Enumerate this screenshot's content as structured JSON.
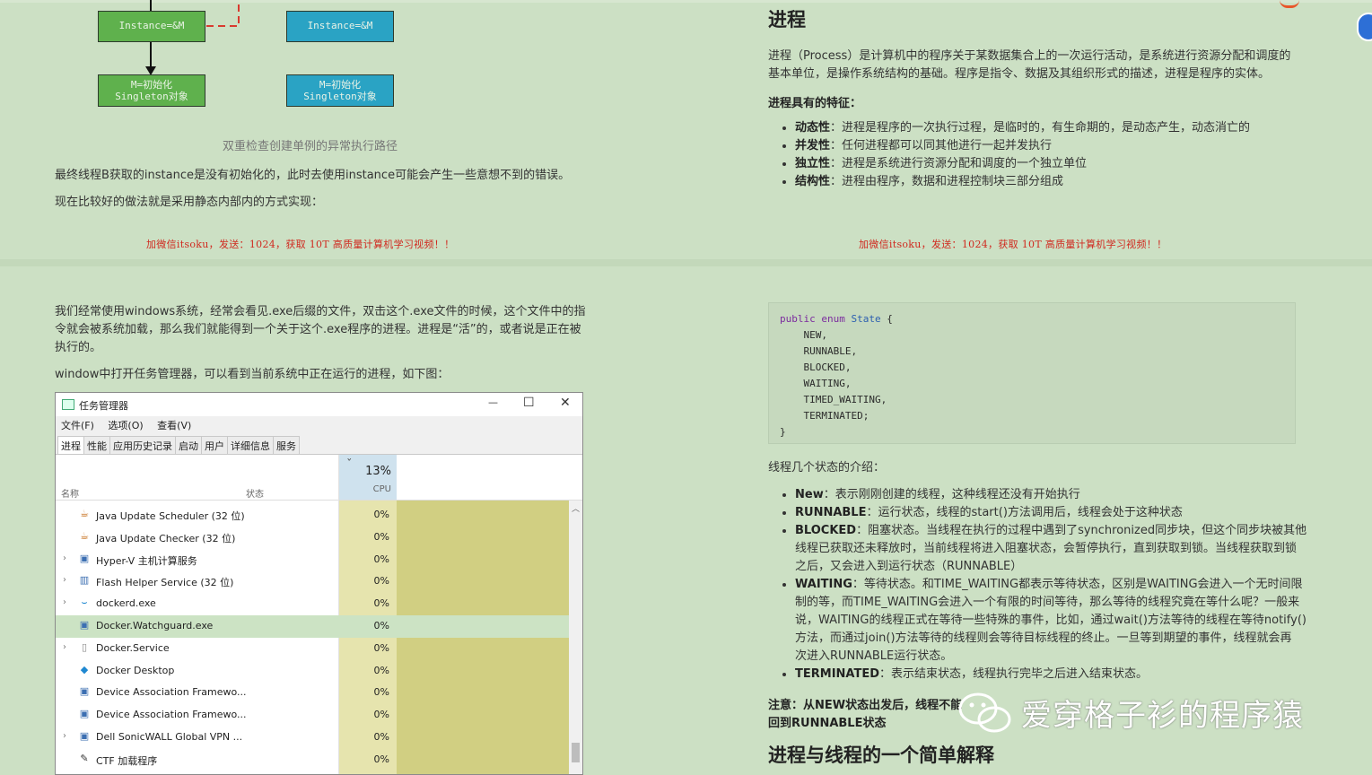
{
  "diagram": {
    "box_left_top": "Instance=&M",
    "box_right_top": "Instance=&M",
    "box_left_bottom_1": "M=初始化",
    "box_left_bottom_2": "Singleton对象",
    "box_right_bottom_1": "M=初始化",
    "box_right_bottom_2": "Singleton对象",
    "caption": "双重检查创建单例的异常执行路径"
  },
  "left_top": {
    "para1": "最终线程B获取的instance是没有初始化的，此时去使用instance可能会产生一些意想不到的错误。",
    "para2": "现在比较好的做法就是采用静态内部内的方式实现：",
    "promo": "加微信itsoku，发送：1024，获取 10T 高质量计算机学习视频！！"
  },
  "right_top": {
    "heading": "进程",
    "para_line1": "进程（Process）是计算机中的程序关于某数据集合上的一次运行活动，是系统进行资源分配和调度的",
    "para_line2": "基本单位，是操作系统结构的基础。程序是指令、数据及其组织形式的描述，进程是程序的实体。",
    "features_title": "进程具有的特征：",
    "features": [
      {
        "term": "动态性",
        "desc": "：进程是程序的一次执行过程，是临时的，有生命期的，是动态产生，动态消亡的"
      },
      {
        "term": "并发性",
        "desc": "：任何进程都可以同其他进行一起并发执行"
      },
      {
        "term": "独立性",
        "desc": "：进程是系统进行资源分配和调度的一个独立单位"
      },
      {
        "term": "结构性",
        "desc": "：进程由程序，数据和进程控制块三部分组成"
      }
    ],
    "promo": "加微信itsoku，发送：1024，获取 10T 高质量计算机学习视频！！"
  },
  "left_bottom": {
    "para1_line1": "我们经常使用windows系统，经常会看见.exe后缀的文件，双击这个.exe文件的时候，这个文件中的指",
    "para1_line2": "令就会被系统加载，那么我们就能得到一个关于这个.exe程序的进程。进程是“活”的，或者说是正在被",
    "para1_line3": "执行的。",
    "para2": "window中打开任务管理器，可以看到当前系统中正在运行的进程，如下图："
  },
  "task_manager": {
    "title": "任务管理器",
    "minimize": "—",
    "maximize": "☐",
    "close": "✕",
    "menu": [
      "文件(F)",
      "选项(O)",
      "查看(V)"
    ],
    "tabs": [
      "进程",
      "性能",
      "应用历史记录",
      "启动",
      "用户",
      "详细信息",
      "服务"
    ],
    "col_name": "名称",
    "col_status": "状态",
    "cpu_percent": "13%",
    "col_cpu": "CPU",
    "sort_arrow": "ˇ",
    "rows": [
      {
        "expand": "",
        "icon": "java-icon",
        "glyph": "☕",
        "name": "Java Update Scheduler (32 位)",
        "cpu": "0%"
      },
      {
        "expand": "",
        "icon": "java-icon",
        "glyph": "☕",
        "name": "Java Update Checker (32 位)",
        "cpu": "0%"
      },
      {
        "expand": "›",
        "icon": "service-icon",
        "glyph": "▣",
        "name": "Hyper-V 主机计算服务",
        "cpu": "0%"
      },
      {
        "expand": "›",
        "icon": "service-icon",
        "glyph": "▥",
        "name": "Flash Helper Service (32 位)",
        "cpu": "0%"
      },
      {
        "expand": "›",
        "icon": "docker-icon",
        "glyph": "⌣",
        "name": "dockerd.exe",
        "cpu": "0%"
      },
      {
        "expand": "",
        "icon": "service-icon",
        "glyph": "▣",
        "name": "Docker.Watchguard.exe",
        "cpu": "0%"
      },
      {
        "expand": "›",
        "icon": "file-icon",
        "glyph": "▯",
        "name": "Docker.Service",
        "cpu": "0%"
      },
      {
        "expand": "",
        "icon": "docker-icon",
        "glyph": "◆",
        "name": "Docker Desktop",
        "cpu": "0%"
      },
      {
        "expand": "",
        "icon": "service-icon",
        "glyph": "▣",
        "name": "Device Association Framewo...",
        "cpu": "0%"
      },
      {
        "expand": "",
        "icon": "service-icon",
        "glyph": "▣",
        "name": "Device Association Framewo...",
        "cpu": "0%"
      },
      {
        "expand": "›",
        "icon": "service-icon",
        "glyph": "▣",
        "name": "Dell SonicWALL Global VPN ...",
        "cpu": "0%"
      },
      {
        "expand": "",
        "icon": "pen-icon",
        "glyph": "✎",
        "name": "CTF 加载程序",
        "cpu": "0%"
      }
    ]
  },
  "right_bottom": {
    "code": [
      "public enum State {",
      "    NEW,",
      "    RUNNABLE,",
      "    BLOCKED,",
      "    WAITING,",
      "    TIMED_WAITING,",
      "    TERMINATED;",
      "}"
    ],
    "states_intro": "线程几个状态的介绍：",
    "states": [
      {
        "term": "New",
        "lines": [
          "：表示刚刚创建的线程，这种线程还没有开始执行"
        ]
      },
      {
        "term": "RUNNABLE",
        "lines": [
          "：运行状态，线程的start()方法调用后，线程会处于这种状态"
        ]
      },
      {
        "term": "BLOCKED",
        "lines": [
          "：阻塞状态。当线程在执行的过程中遇到了synchronized同步块，但这个同步块被其他",
          "线程已获取还未释放时，当前线程将进入阻塞状态，会暂停执行，直到获取到锁。当线程获取到锁",
          "之后，又会进入到运行状态（RUNNABLE）"
        ]
      },
      {
        "term": "WAITING",
        "lines": [
          "：等待状态。和TIME_WAITING都表示等待状态，区别是WAITING会进入一个无时间限",
          "制的等，而TIME_WAITING会进入一个有限的时间等待，那么等待的线程究竟在等什么呢？一般来",
          "说，WAITING的线程正式在等待一些特殊的事件，比如，通过wait()方法等待的线程在等待notify()",
          "方法，而通过join()方法等待的线程则会等待目标线程的终止。一旦等到期望的事件，线程就会再",
          "次进入RUNNABLE运行状态。"
        ]
      },
      {
        "term": "TERMINATED",
        "lines": [
          "：表示结束状态，线程执行完毕之后进入结束状态。"
        ]
      }
    ],
    "note_line1": "注意：从NEW状态出发后，线程不能",
    "note_line2": "回到RUNNABLE状态",
    "heading2": "进程与线程的一个简单解释"
  },
  "watermark": "爱穿格子衫的程序猿"
}
